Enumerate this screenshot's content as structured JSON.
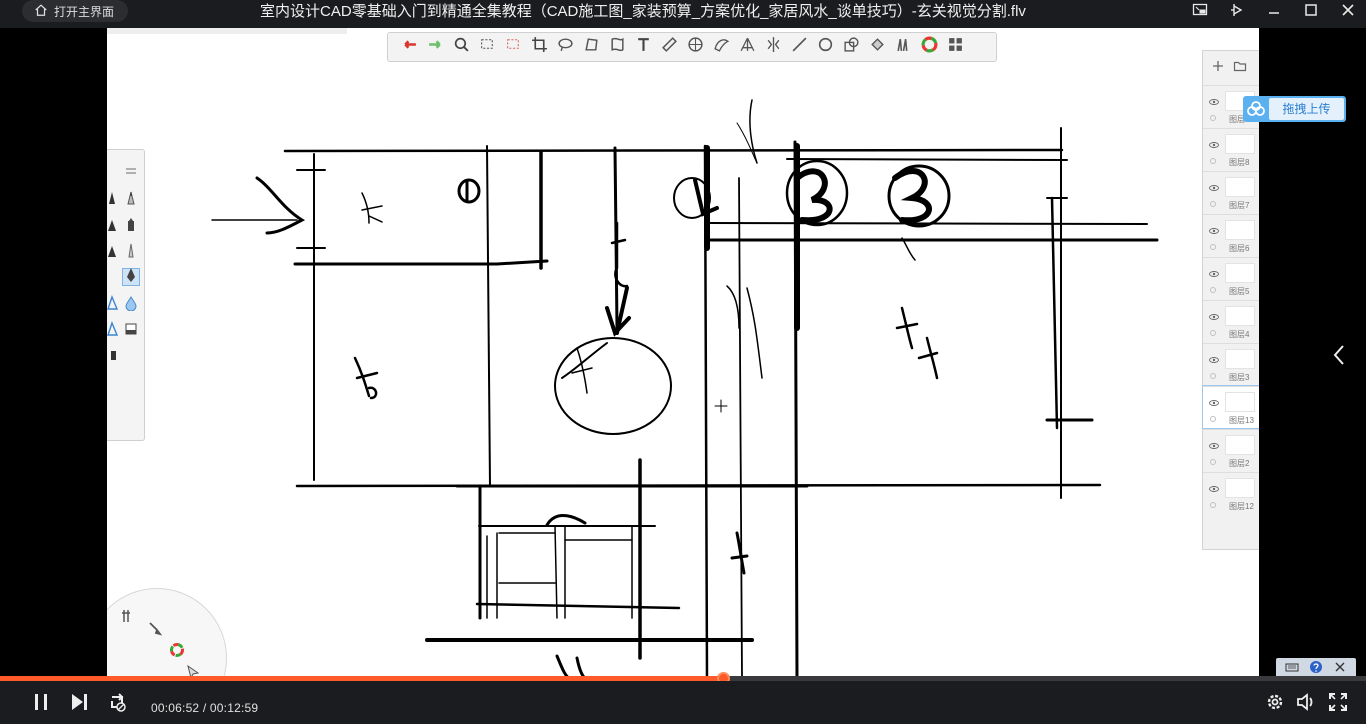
{
  "window": {
    "title": "室内设计CAD零基础入门到精通全集教程（CAD施工图_家装预算_方案优化_家居风水_谈单技巧）-玄关视觉分割.flv",
    "home_button": "打开主界面"
  },
  "upload": {
    "label": "拖拽上传"
  },
  "layers": [
    {
      "name": "图层9"
    },
    {
      "name": "图层8"
    },
    {
      "name": "图层7"
    },
    {
      "name": "图层6"
    },
    {
      "name": "图层5"
    },
    {
      "name": "图层4"
    },
    {
      "name": "图层3"
    },
    {
      "name": "图层13",
      "active": true
    },
    {
      "name": "图层2"
    },
    {
      "name": "图层12"
    }
  ],
  "player": {
    "current_time": "00:06:52",
    "total_time": "00:12:59",
    "time_display": "00:06:52 / 00:12:59",
    "progress_fraction": 0.529
  },
  "colors": {
    "accent": "#ff5a2a",
    "upload_blue": "#5bb0f0"
  }
}
